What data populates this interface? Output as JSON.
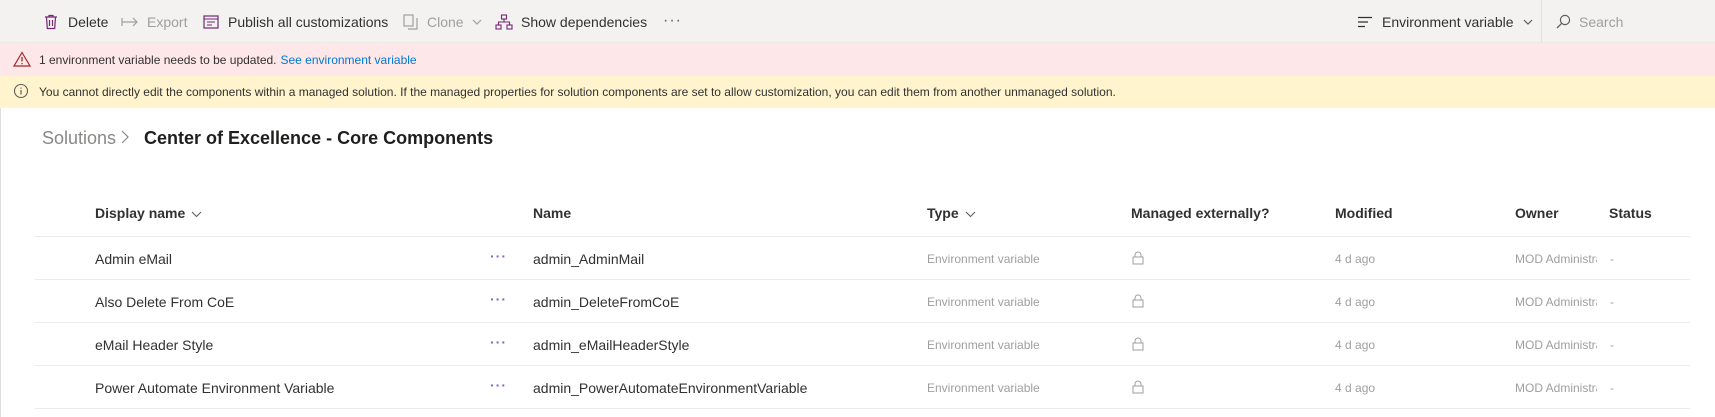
{
  "toolbar": {
    "delete_label": "Delete",
    "export_label": "Export",
    "publish_label": "Publish all customizations",
    "clone_label": "Clone",
    "show_deps_label": "Show dependencies",
    "more_label": "···",
    "filter_label": "Environment variable",
    "search_placeholder": "Search"
  },
  "banners": {
    "error_text": "1 environment variable needs to be updated.",
    "error_link": "See environment variable",
    "info_text": "You cannot directly edit the components within a managed solution. If the managed properties for solution components are set to allow customization, you can edit them from another unmanaged solution."
  },
  "breadcrumb": {
    "root": "Solutions",
    "separator": ">",
    "current": "Center of Excellence - Core Components"
  },
  "table": {
    "headers": {
      "display_name": "Display name",
      "name": "Name",
      "type": "Type",
      "managed": "Managed externally?",
      "modified": "Modified",
      "owner": "Owner",
      "status": "Status"
    },
    "rows": [
      {
        "display_name": "Admin eMail",
        "more": "···",
        "name": "admin_AdminMail",
        "type": "Environment variable",
        "modified": "4 d ago",
        "owner": "MOD Administrator",
        "status": "-"
      },
      {
        "display_name": "Also Delete From CoE",
        "more": "···",
        "name": "admin_DeleteFromCoE",
        "type": "Environment variable",
        "modified": "4 d ago",
        "owner": "MOD Administrator",
        "status": "-"
      },
      {
        "display_name": "eMail Header Style",
        "more": "···",
        "name": "admin_eMailHeaderStyle",
        "type": "Environment variable",
        "modified": "4 d ago",
        "owner": "MOD Administrator",
        "status": "-"
      },
      {
        "display_name": "Power Automate Environment Variable",
        "more": "···",
        "name": "admin_PowerAutomateEnvironmentVariable",
        "type": "Environment variable",
        "modified": "4 d ago",
        "owner": "MOD Administrator",
        "status": "-"
      }
    ]
  },
  "colors": {
    "accent": "#742774",
    "link": "#0078d4",
    "error_bg": "#fde7e9",
    "warning_bg": "#fff4ce",
    "row_more": "#8764b8"
  },
  "icons": [
    "trash-icon",
    "export-arrow-icon",
    "publish-icon",
    "clone-icon",
    "dependencies-icon",
    "more-icon",
    "filter-lines-icon",
    "search-icon",
    "warning-triangle-icon",
    "info-circle-icon",
    "lock-icon",
    "chevron-down-icon",
    "chevron-right-icon"
  ]
}
